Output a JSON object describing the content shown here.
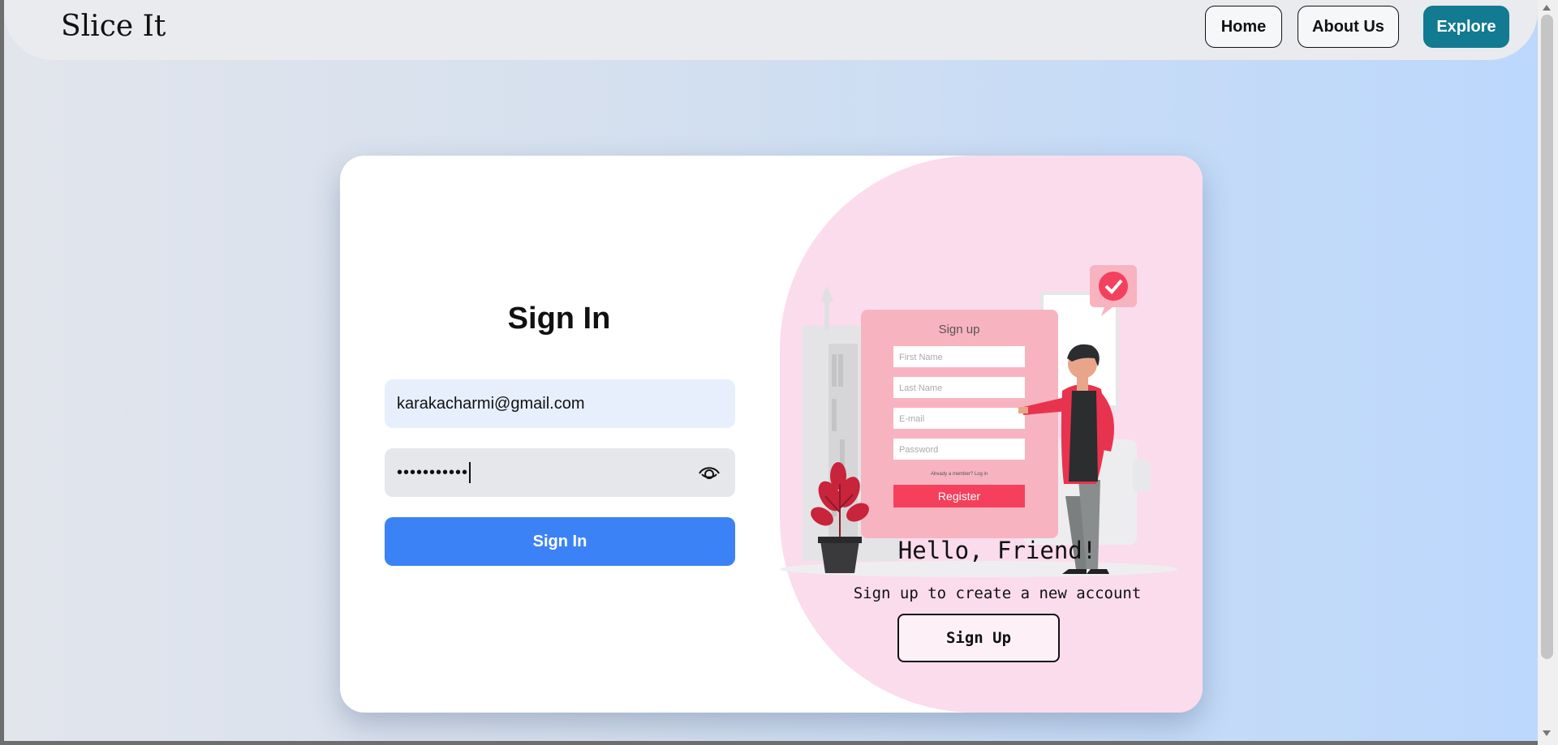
{
  "nav": {
    "brand": "Slice It",
    "home": "Home",
    "about": "About Us",
    "explore": "Explore"
  },
  "signin": {
    "title": "Sign In",
    "email_value": "karakacharmi@gmail.com",
    "password_masked": "•••••••••••",
    "button": "Sign In"
  },
  "overlay": {
    "hello": "Hello, Friend!",
    "subtitle": "Sign up to create a new account",
    "button": "Sign Up",
    "illustration": {
      "title": "Sign up",
      "fields": [
        "First Name",
        "Last Name",
        "E-mail",
        "Password"
      ],
      "note": "Already a member? Log in",
      "register": "Register"
    }
  },
  "colors": {
    "accent": "#3b82f6",
    "explore": "#127a91",
    "overlay_bg": "#fbdcec",
    "register": "#f4405d"
  }
}
